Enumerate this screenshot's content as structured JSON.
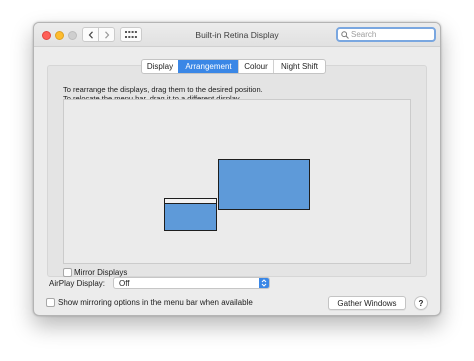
{
  "window": {
    "title": "Built-in Retina Display",
    "search_placeholder": "Search"
  },
  "tabs": [
    {
      "label": "Display",
      "active": false
    },
    {
      "label": "Arrangement",
      "active": true
    },
    {
      "label": "Colour",
      "active": false
    },
    {
      "label": "Night Shift",
      "active": false
    }
  ],
  "arrangement": {
    "instruction_line1": "To rearrange the displays, drag them to the desired position.",
    "instruction_line2": "To relocate the menu bar, drag it to a different display."
  },
  "mirror_displays": {
    "label": "Mirror Displays",
    "checked": false
  },
  "airplay": {
    "label": "AirPlay Display:",
    "value": "Off"
  },
  "show_mirroring": {
    "label": "Show mirroring options in the menu bar when available",
    "checked": false
  },
  "buttons": {
    "gather_windows": "Gather Windows",
    "help": "?"
  },
  "colors": {
    "accent": "#3a87e6",
    "display_fill": "#5e9ad9"
  },
  "icons": [
    "close-icon",
    "minimize-icon",
    "zoom-icon",
    "chevron-left-icon",
    "chevron-right-icon",
    "grid-icon",
    "search-icon",
    "updown-arrows-icon"
  ]
}
